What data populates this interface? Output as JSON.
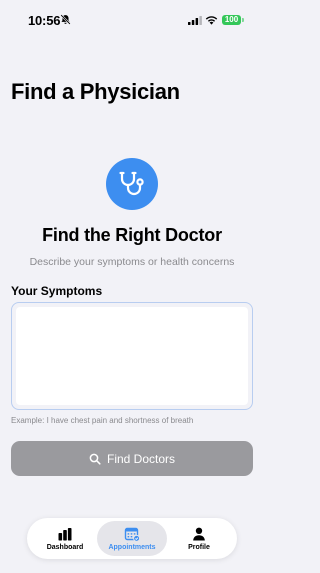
{
  "status_bar": {
    "time": "10:56",
    "battery": "100"
  },
  "page": {
    "title": "Find a Physician"
  },
  "hero": {
    "icon": "stethoscope-icon",
    "title": "Find the Right Doctor",
    "subtitle": "Describe your symptoms or health concerns"
  },
  "form": {
    "label": "Your Symptoms",
    "value": "",
    "example": "Example: I have chest pain and shortness of breath",
    "button_label": "Find Doctors"
  },
  "tabs": [
    {
      "label": "Dashboard",
      "icon": "chart-bars-icon",
      "active": false
    },
    {
      "label": "Appointments",
      "icon": "calendar-icon",
      "active": true
    },
    {
      "label": "Profile",
      "icon": "person-icon",
      "active": false
    }
  ],
  "colors": {
    "accent": "#3d8ef0",
    "background": "#f2f2f7",
    "button_disabled": "#9a9a9e",
    "battery": "#34c759"
  }
}
